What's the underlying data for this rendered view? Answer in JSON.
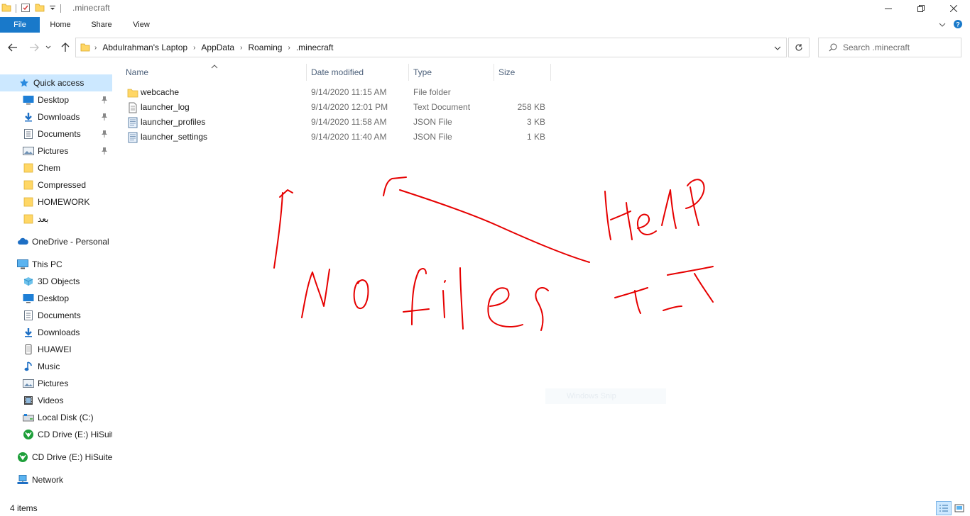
{
  "window": {
    "title": ".minecraft",
    "minimize_icon": "minimize-icon",
    "restore_icon": "restore-icon",
    "close_icon": "close-icon"
  },
  "ribbon": {
    "tabs": [
      {
        "label": "File"
      },
      {
        "label": "Home"
      },
      {
        "label": "Share"
      },
      {
        "label": "View"
      }
    ],
    "accent_color": "#1979ca"
  },
  "address": {
    "breadcrumbs": [
      "Abdulrahman's Laptop",
      "AppData",
      "Roaming",
      ".minecraft"
    ]
  },
  "search": {
    "placeholder": "Search .minecraft"
  },
  "sidebar": {
    "items": [
      {
        "label": "Quick access",
        "icon": "star-icon",
        "pinned": false
      },
      {
        "label": "Desktop",
        "icon": "desktop-icon",
        "pinned": true
      },
      {
        "label": "Downloads",
        "icon": "download-icon",
        "pinned": true
      },
      {
        "label": "Documents",
        "icon": "document-icon",
        "pinned": true
      },
      {
        "label": "Pictures",
        "icon": "pictures-icon",
        "pinned": true
      },
      {
        "label": "Chem",
        "icon": "folder-icon",
        "pinned": false
      },
      {
        "label": "Compressed",
        "icon": "folder-icon",
        "pinned": false
      },
      {
        "label": "HOMEWORK",
        "icon": "folder-icon",
        "pinned": false
      },
      {
        "label": "بعد",
        "icon": "folder-icon",
        "pinned": false
      },
      {
        "label": "OneDrive - Personal",
        "icon": "cloud-icon",
        "pinned": false
      },
      {
        "label": "This PC",
        "icon": "computer-icon",
        "pinned": false
      },
      {
        "label": "3D Objects",
        "icon": "cube-icon",
        "pinned": false
      },
      {
        "label": "Desktop",
        "icon": "desktop-icon",
        "pinned": false
      },
      {
        "label": "Documents",
        "icon": "document-icon",
        "pinned": false
      },
      {
        "label": "Downloads",
        "icon": "download-icon",
        "pinned": false
      },
      {
        "label": "HUAWEI",
        "icon": "phone-icon",
        "pinned": false
      },
      {
        "label": "Music",
        "icon": "music-icon",
        "pinned": false
      },
      {
        "label": "Pictures",
        "icon": "pictures-icon",
        "pinned": false
      },
      {
        "label": "Videos",
        "icon": "video-icon",
        "pinned": false
      },
      {
        "label": "Local Disk (C:)",
        "icon": "disk-icon",
        "pinned": false
      },
      {
        "label": "CD Drive (E:) HiSuite",
        "icon": "cd-drive-icon",
        "pinned": false
      },
      {
        "label": "CD Drive (E:) HiSuite",
        "icon": "cd-drive-icon",
        "pinned": false
      },
      {
        "label": "Network",
        "icon": "network-icon",
        "pinned": false
      }
    ],
    "selected_color": "#cce8ff"
  },
  "columns": {
    "name": "Name",
    "date": "Date modified",
    "type": "Type",
    "size": "Size"
  },
  "files": [
    {
      "name": "webcache",
      "date": "9/14/2020 11:15 AM",
      "type": "File folder",
      "size": "",
      "icon": "folder-icon"
    },
    {
      "name": "launcher_log",
      "date": "9/14/2020 12:01 PM",
      "type": "Text Document",
      "size": "258 KB",
      "icon": "text-file-icon"
    },
    {
      "name": "launcher_profiles",
      "date": "9/14/2020 11:58 AM",
      "type": "JSON File",
      "size": "3 KB",
      "icon": "json-file-icon"
    },
    {
      "name": "launcher_settings",
      "date": "9/14/2020 11:40 AM",
      "type": "JSON File",
      "size": "1 KB",
      "icon": "json-file-icon"
    }
  ],
  "annotation": {
    "color": "#e60000"
  },
  "faint_overlay": "Windows Snip",
  "status": {
    "item_count": "4 items"
  }
}
